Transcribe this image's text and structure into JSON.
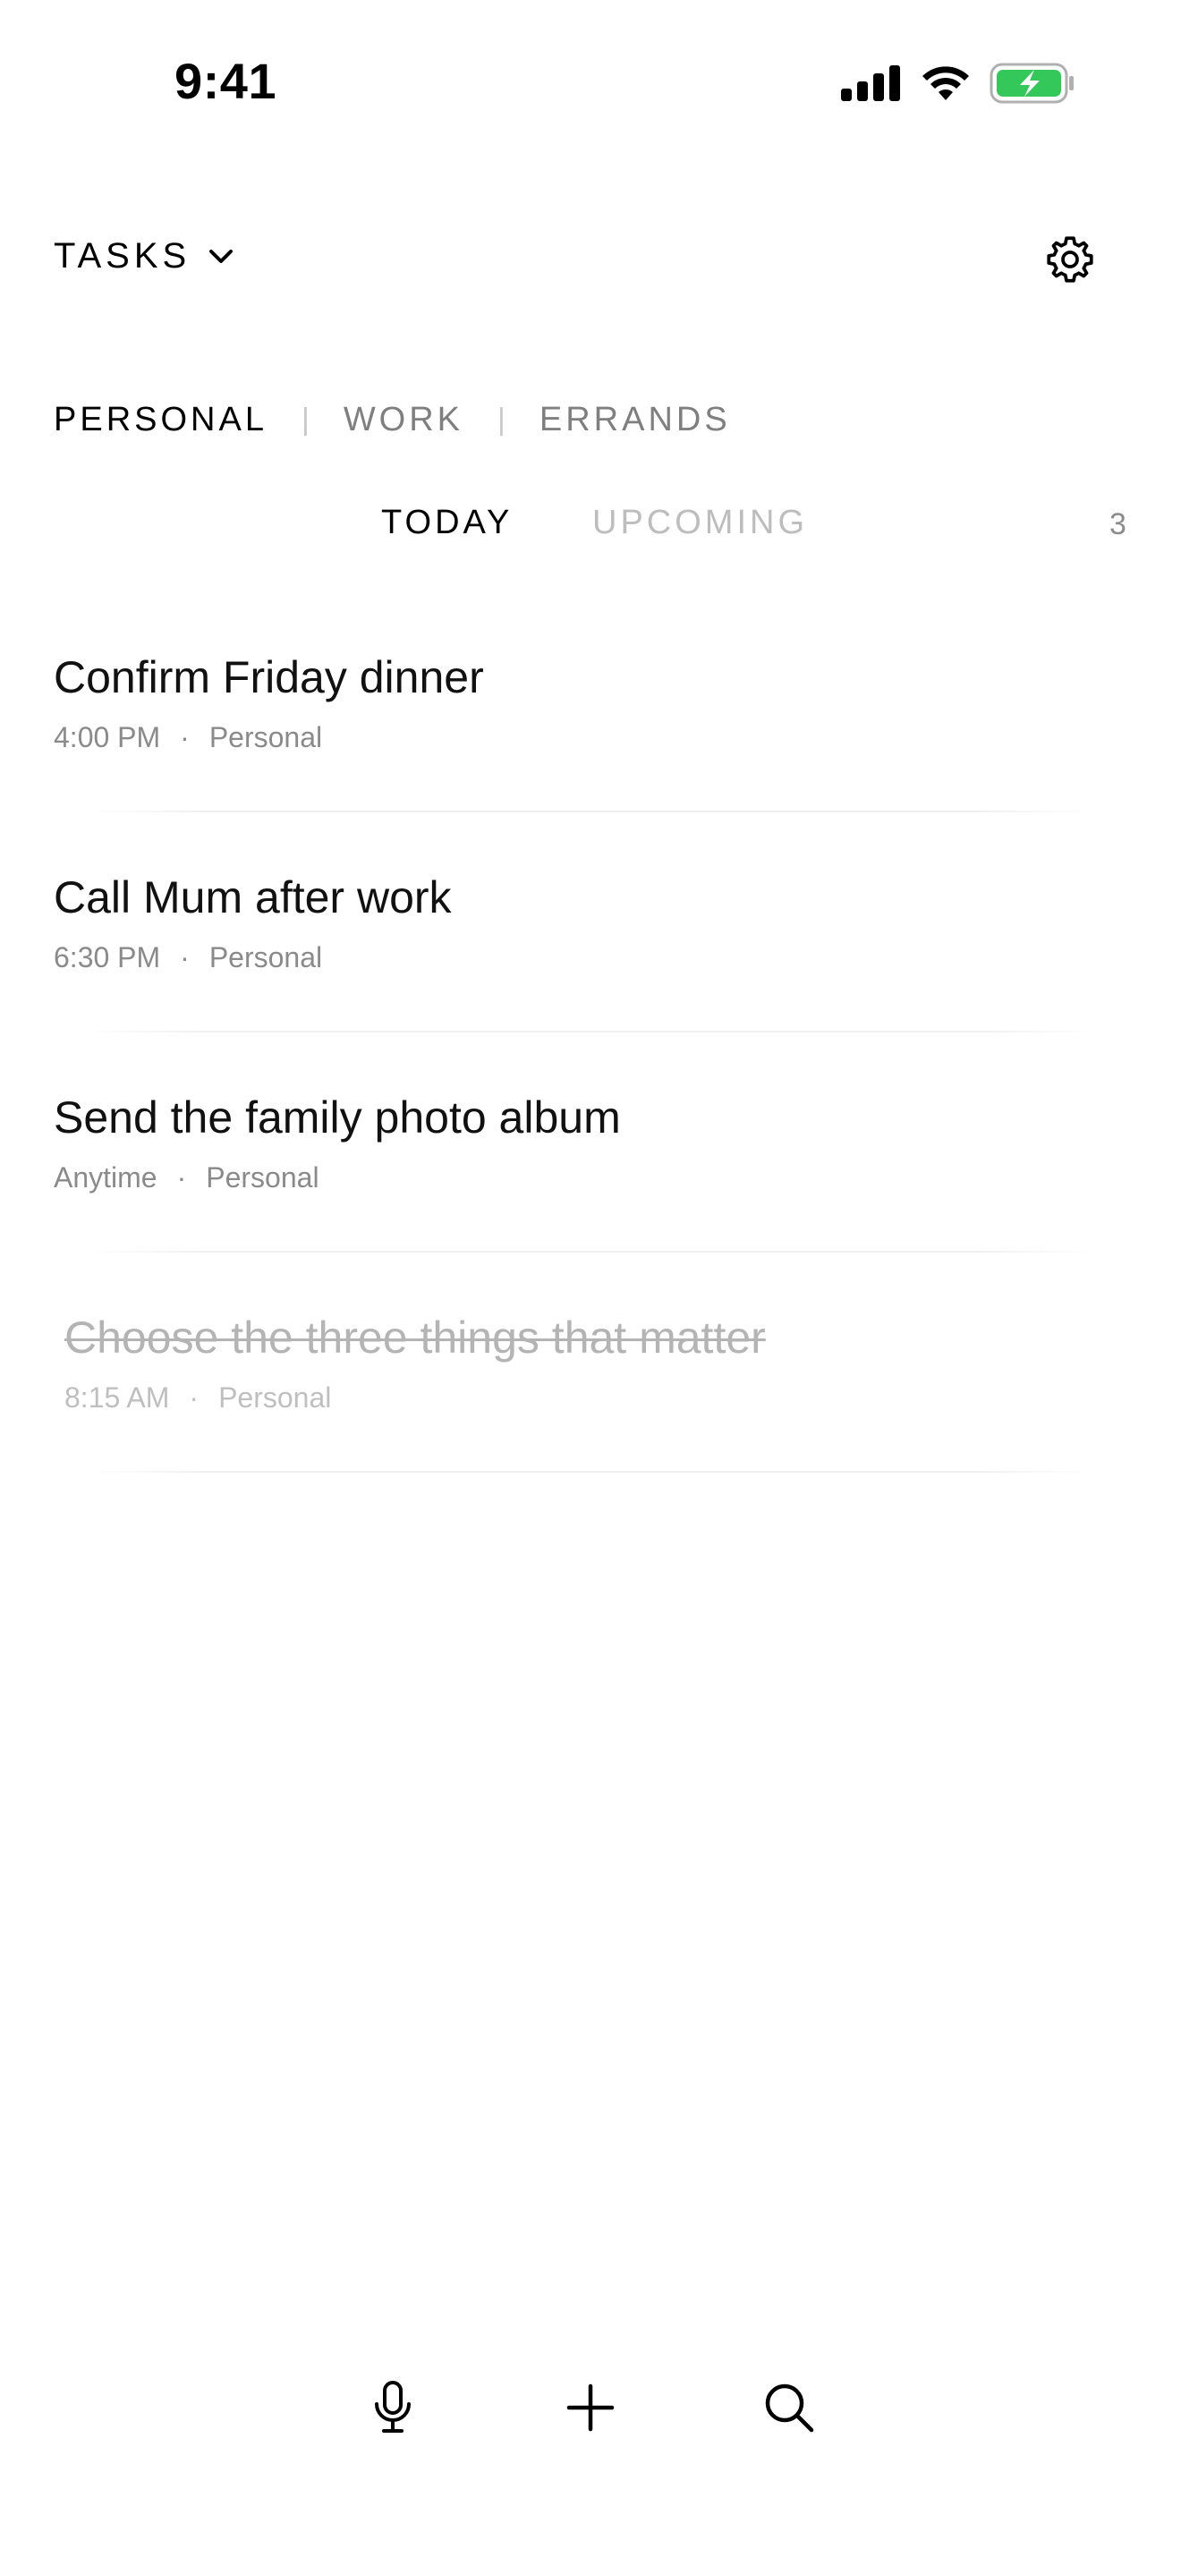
{
  "status_bar": {
    "time": "9:41",
    "icons": [
      "cellular-signal-icon",
      "wifi-icon",
      "battery-charging-icon"
    ],
    "battery_color": "#34c759"
  },
  "header": {
    "title": "TASKS",
    "title_icon": "chevron-down-icon",
    "settings_icon": "gear-icon"
  },
  "categories": [
    {
      "label": "PERSONAL",
      "active": true
    },
    {
      "label": "WORK",
      "active": false
    },
    {
      "label": "ERRANDS",
      "active": false
    }
  ],
  "category_separator": "|",
  "view_tabs": {
    "today": "TODAY",
    "upcoming": "UPCOMING",
    "active": "today"
  },
  "task_count": "3",
  "tasks": [
    {
      "title": "Confirm Friday dinner",
      "time": "4:00 PM",
      "separator": "·",
      "list": "Personal",
      "completed": false
    },
    {
      "title": "Call Mum after work",
      "time": "6:30 PM",
      "separator": "·",
      "list": "Personal",
      "completed": false
    },
    {
      "title": "Send the family photo album",
      "time": "Anytime",
      "separator": "·",
      "list": "Personal",
      "completed": false
    },
    {
      "title": "Choose the three things that matter",
      "time": "8:15 AM",
      "separator": "·",
      "list": "Personal",
      "completed": true
    }
  ],
  "toolbar": {
    "icons": [
      "microphone-icon",
      "plus-icon",
      "search-icon"
    ]
  }
}
